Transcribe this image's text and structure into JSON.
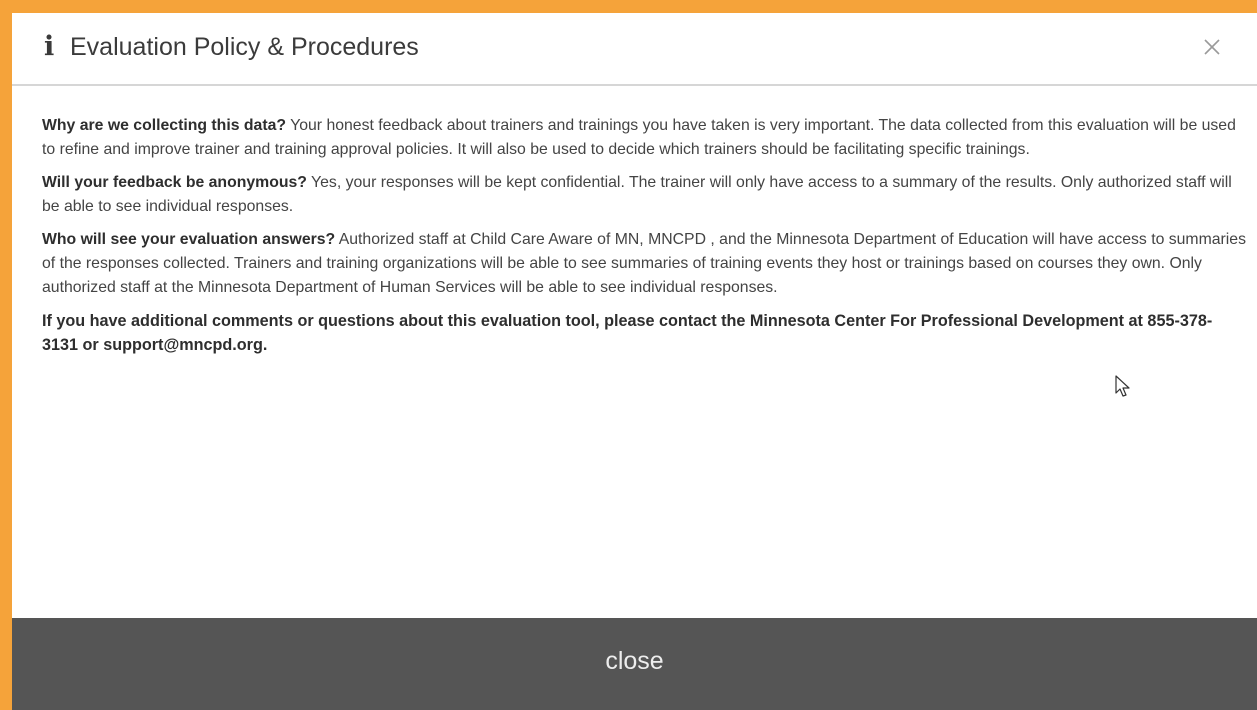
{
  "dialog": {
    "title": "Evaluation Policy & Procedures",
    "info_icon": "info-icon",
    "close_icon": "close-icon",
    "sections": [
      {
        "question": "Why are we collecting this data?",
        "answer": " Your honest feedback about trainers and trainings you have taken is very important. The data collected from this evaluation will be used to refine and improve trainer and training approval policies. It will also be used to decide which trainers should be facilitating specific trainings."
      },
      {
        "question": "Will your feedback be anonymous?",
        "answer": " Yes, your responses will be kept confidential. The trainer will only have access to a summary of the results. Only authorized staff will be able to see individual responses."
      },
      {
        "question": "Who will see your evaluation answers?",
        "answer": " Authorized staff at Child Care Aware of MN, MNCPD , and the Minnesota Department of Education will have access to summaries of the responses collected. Trainers and training organizations will be able to see summaries of training events they host or trainings based on courses they own. Only authorized staff at the Minnesota Department of Human Services will be able to see individual responses."
      }
    ],
    "contact_note": "If you have additional comments or questions about this evaluation tool, please contact the Minnesota Center For Professional Development at 855-378-3131 or support@mncpd.org.",
    "close_label": "close"
  },
  "colors": {
    "frame_border": "#f5a33a",
    "footer_bg": "#555555",
    "footer_text": "#ededed",
    "body_text": "#444444"
  }
}
